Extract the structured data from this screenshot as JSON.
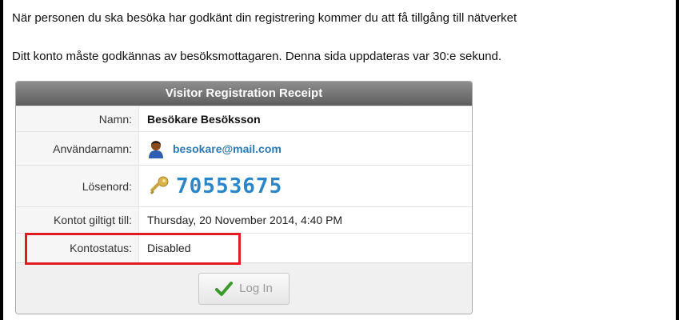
{
  "messages": {
    "line1": "När personen du ska besöka har godkänt din registrering kommer du att få tillgång till nätverket",
    "line2": "Ditt konto måste godkännas av besöksmottagaren. Denna sida uppdateras var 30:e sekund."
  },
  "receipt": {
    "title": "Visitor Registration Receipt",
    "rows": {
      "name": {
        "label": "Namn:",
        "value": "Besökare Besöksson"
      },
      "username": {
        "label": "Användarnamn:",
        "value": "besokare@mail.com",
        "icon": "user-avatar-icon"
      },
      "password": {
        "label": "Lösenord:",
        "value": "70553675",
        "icon": "key-icon"
      },
      "valid_until": {
        "label": "Kontot giltigt till:",
        "value": "Thursday, 20 November 2014, 4:40 PM"
      },
      "status": {
        "label": "Kontostatus:",
        "value": "Disabled"
      }
    },
    "login_button": {
      "label": "Log In",
      "icon": "checkmark-icon",
      "enabled": false
    }
  },
  "colors": {
    "header_bg": "#6e6e6e",
    "link": "#2a7ab5",
    "password": "#2a86c8",
    "highlight": "#e01b24",
    "check": "#3a9a2a"
  }
}
